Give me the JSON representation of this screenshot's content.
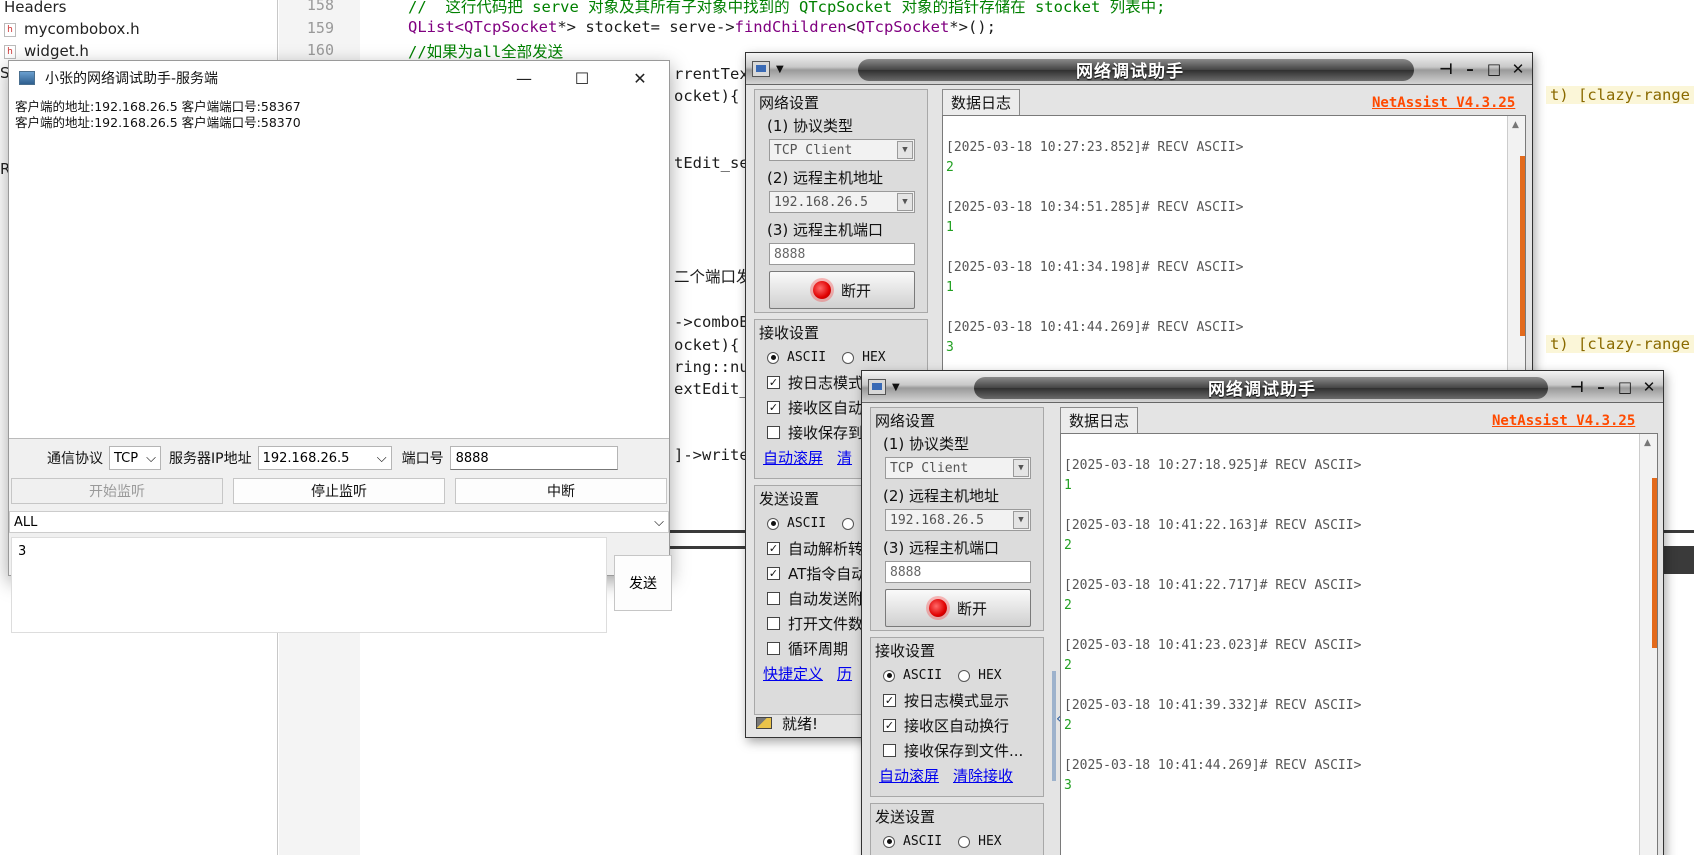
{
  "ide": {
    "file_tree": [
      {
        "label": "Headers",
        "icon": ""
      },
      {
        "label": "mycombobox.h",
        "icon": "h-file-icon"
      },
      {
        "label": "widget.h",
        "icon": "h-file-icon"
      }
    ],
    "tree_cutoffs": [
      "S",
      "R"
    ],
    "line_numbers": [
      "158",
      "159",
      "160"
    ],
    "code_lines": [
      {
        "comment": "//  这行代码把 serve 对象及其所有子对象中找到的 QTcpSocket 对象的指针存储在 stocket 列表中;"
      },
      {
        "t1": "QList<",
        "t2": "QTcpSocket",
        "t3": "*> stocket= serve->",
        "t4": "findChildren",
        "t5": "<",
        "t6": "QTcpSocket",
        "t7": "*>();"
      },
      {
        "comment": "//如果为all全部发送"
      }
    ],
    "code_fragments": [
      "rrentText",
      "ocket){",
      "tEdit_sen",
      "二个端口发",
      "->comboBo",
      "ocket){",
      "ring::nu",
      "extEdit_",
      "]->write("
    ],
    "hint_text": "t) [clazy-range"
  },
  "qt_server": {
    "title": "小张的网络调试助手-服务端",
    "title_icon": "app-window-icon",
    "controls": {
      "minimize": "—",
      "maximize": "☐",
      "close": "✕"
    },
    "log_lines": [
      "客户端的地址:192.168.26.5 客户端端口号:58367",
      "客户端的地址:192.168.26.5 客户端端口号:58370"
    ],
    "protocol_label": "通信协议",
    "protocol_value": "TCP",
    "ip_label": "服务器IP地址",
    "ip_value": "192.168.26.5",
    "port_label": "端口号",
    "port_value": "8888",
    "start_btn": "开始监听",
    "stop_btn": "停止监听",
    "break_btn": "中断",
    "target_value": "ALL",
    "send_text": "3",
    "send_btn": "发送"
  },
  "netassist_back": {
    "title": "网络调试助手",
    "version": "NetAssist V4.3.25",
    "tab": "数据日志",
    "net_group": "网络设置",
    "proto_label": "(1) 协议类型",
    "proto_value": "TCP Client",
    "host_label": "(2) 远程主机地址",
    "host_value": "192.168.26.5",
    "port_label": "(3) 远程主机端口",
    "port_value": "8888",
    "connect_btn": "断开",
    "recv_group": "接收设置",
    "recv_ascii": "ASCII",
    "recv_hex": "HEX",
    "recv_opts": [
      "按日志模式",
      "接收区自动",
      "接收保存到"
    ],
    "recv_links": [
      "自动滚屏",
      "清"
    ],
    "send_group": "发送设置",
    "send_ascii": "ASCII",
    "send_opts": [
      "自动解析转",
      "AT指令自动",
      "自动发送附",
      "打开文件数",
      "循环周期"
    ],
    "send_links": [
      "快捷定义",
      "历"
    ],
    "status": "就绪!",
    "log": [
      {
        "head": "[2025-03-18 10:27:23.852]# RECV ASCII>",
        "value": "2"
      },
      {
        "head": "[2025-03-18 10:34:51.285]# RECV ASCII>",
        "value": "1"
      },
      {
        "head": "[2025-03-18 10:41:34.198]# RECV ASCII>",
        "value": "1"
      },
      {
        "head": "[2025-03-18 10:41:44.269]# RECV ASCII>",
        "value": "3"
      }
    ]
  },
  "netassist_front": {
    "title": "网络调试助手",
    "version": "NetAssist V4.3.25",
    "tab": "数据日志",
    "net_group": "网络设置",
    "proto_label": "(1) 协议类型",
    "proto_value": "TCP Client",
    "host_label": "(2) 远程主机地址",
    "host_value": "192.168.26.5",
    "port_label": "(3) 远程主机端口",
    "port_value": "8888",
    "connect_btn": "断开",
    "recv_group": "接收设置",
    "recv_ascii": "ASCII",
    "recv_hex": "HEX",
    "recv_opts": [
      "按日志模式显示",
      "接收区自动换行",
      "接收保存到文件..."
    ],
    "recv_links": [
      "自动滚屏",
      "清除接收"
    ],
    "send_group": "发送设置",
    "send_ascii": "ASCII",
    "send_hex": "HEX",
    "log": [
      {
        "head": "[2025-03-18 10:27:18.925]# RECV ASCII>",
        "value": "1"
      },
      {
        "head": "[2025-03-18 10:41:22.163]# RECV ASCII>",
        "value": "2"
      },
      {
        "head": "[2025-03-18 10:41:22.717]# RECV ASCII>",
        "value": "2"
      },
      {
        "head": "[2025-03-18 10:41:23.023]# RECV ASCII>",
        "value": "2"
      },
      {
        "head": "[2025-03-18 10:41:39.332]# RECV ASCII>",
        "value": "2"
      },
      {
        "head": "[2025-03-18 10:41:44.269]# RECV ASCII>",
        "value": "3"
      }
    ]
  },
  "colors": {
    "version_link": "#ff4a00",
    "log_value": "#22a022",
    "connect_led": "#e00000",
    "link": "#0000ee",
    "scroll_thumb": "#e36a1c"
  }
}
